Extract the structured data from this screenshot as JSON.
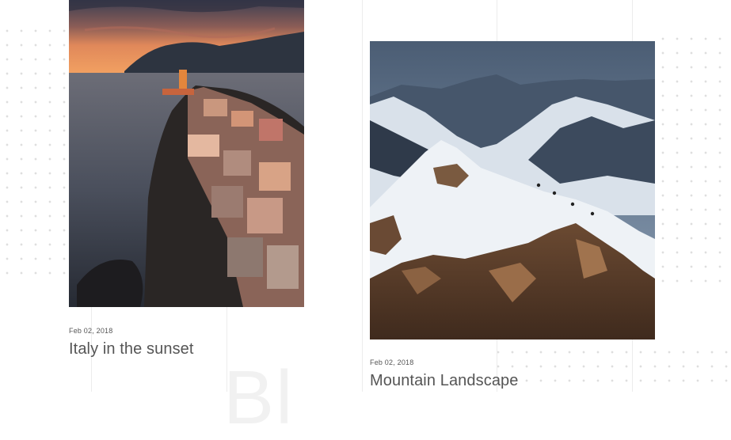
{
  "posts": [
    {
      "date": "Feb 02, 2018",
      "title": "Italy in the sunset",
      "image_subject": "cliffside village at sunset"
    },
    {
      "date": "Feb 02, 2018",
      "title": "Mountain Landscape",
      "image_subject": "snowy mountain ridge with climbers"
    }
  ],
  "background_text": "Bl",
  "colors": {
    "text": "#555555",
    "dots": "#dedede",
    "gridline": "#ececec",
    "background_text": "#f1f1f1"
  }
}
